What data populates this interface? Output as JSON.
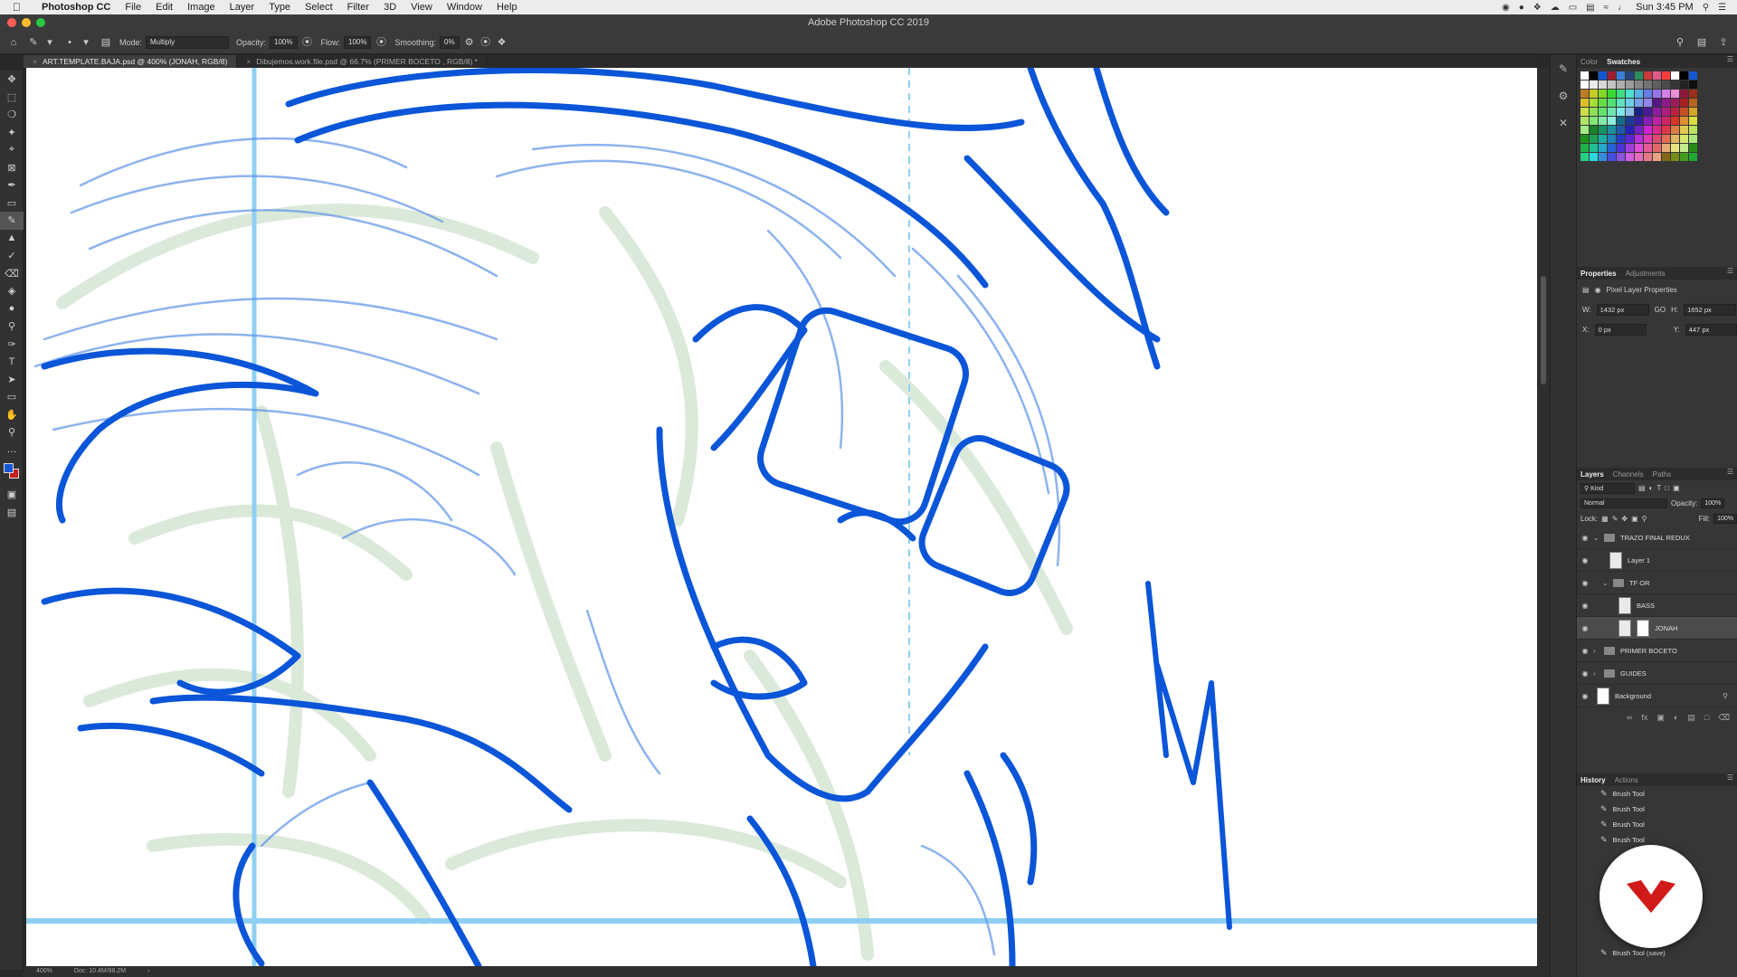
{
  "menubar": {
    "app": "Photoshop CC",
    "items": [
      "File",
      "Edit",
      "Image",
      "Layer",
      "Type",
      "Select",
      "Filter",
      "3D",
      "View",
      "Window",
      "Help"
    ],
    "clock": "Sun 3:45 PM"
  },
  "window_title": "Adobe Photoshop CC 2019",
  "options": {
    "mode_label": "Mode:",
    "mode_value": "Multiply",
    "opacity_label": "Opacity:",
    "opacity_value": "100%",
    "flow_label": "Flow:",
    "flow_value": "100%",
    "smoothing_label": "Smoothing:",
    "smoothing_value": "0%"
  },
  "doc_tabs": [
    {
      "label": "ART.TEMPLATE.BAJA.psd @ 400% (JONAH, RGB/8)",
      "active": true
    },
    {
      "label": "Dibujemos.work.file.psd @ 66.7% (PRIMER BOCETO , RGB/8) *",
      "active": false
    }
  ],
  "status": {
    "zoom": "400%",
    "doc": "Doc: 10.4M/98.2M"
  },
  "colors_panel": {
    "tab_color": "Color",
    "tab_swatches": "Swatches"
  },
  "properties_panel": {
    "tab_properties": "Properties",
    "tab_adjustments": "Adjustments",
    "subtitle": "Pixel Layer Properties",
    "w_label": "W:",
    "w_value": "1432 px",
    "h_label": "H:",
    "h_value": "1652 px",
    "x_label": "X:",
    "x_value": "0 px",
    "y_label": "Y:",
    "y_value": "447 px",
    "link_icon_text": "GO"
  },
  "layers_panel": {
    "tab_layers": "Layers",
    "tab_channels": "Channels",
    "tab_paths": "Paths",
    "kind": "Kind",
    "blend": "Normal",
    "opacity_label": "Opacity:",
    "opacity_value": "100%",
    "lock_label": "Lock:",
    "fill_label": "Fill:",
    "fill_value": "100%",
    "layers": [
      {
        "name": "TRAZO FINAL REDUX",
        "type": "group"
      },
      {
        "name": "Layer 1",
        "type": "layer"
      },
      {
        "name": "TF OR",
        "type": "group"
      },
      {
        "name": "BASS",
        "type": "layer"
      },
      {
        "name": "JONAH",
        "type": "layer-mask",
        "selected": true
      },
      {
        "name": "PRIMER BOCETO",
        "type": "group"
      },
      {
        "name": "GUIDES",
        "type": "group"
      },
      {
        "name": "Background",
        "type": "background"
      }
    ]
  },
  "history_panel": {
    "tab_history": "History",
    "tab_actions": "Actions",
    "items": [
      "Brush Tool",
      "Brush Tool",
      "Brush Tool",
      "Brush Tool",
      "Brush Tool (save)"
    ]
  },
  "accent_colors": {
    "stroke_blue": "#0a55d8",
    "guide_blue": "#6fc4ef",
    "sketch_green": "#cfe2cd",
    "logo_red": "#d11a1a"
  }
}
